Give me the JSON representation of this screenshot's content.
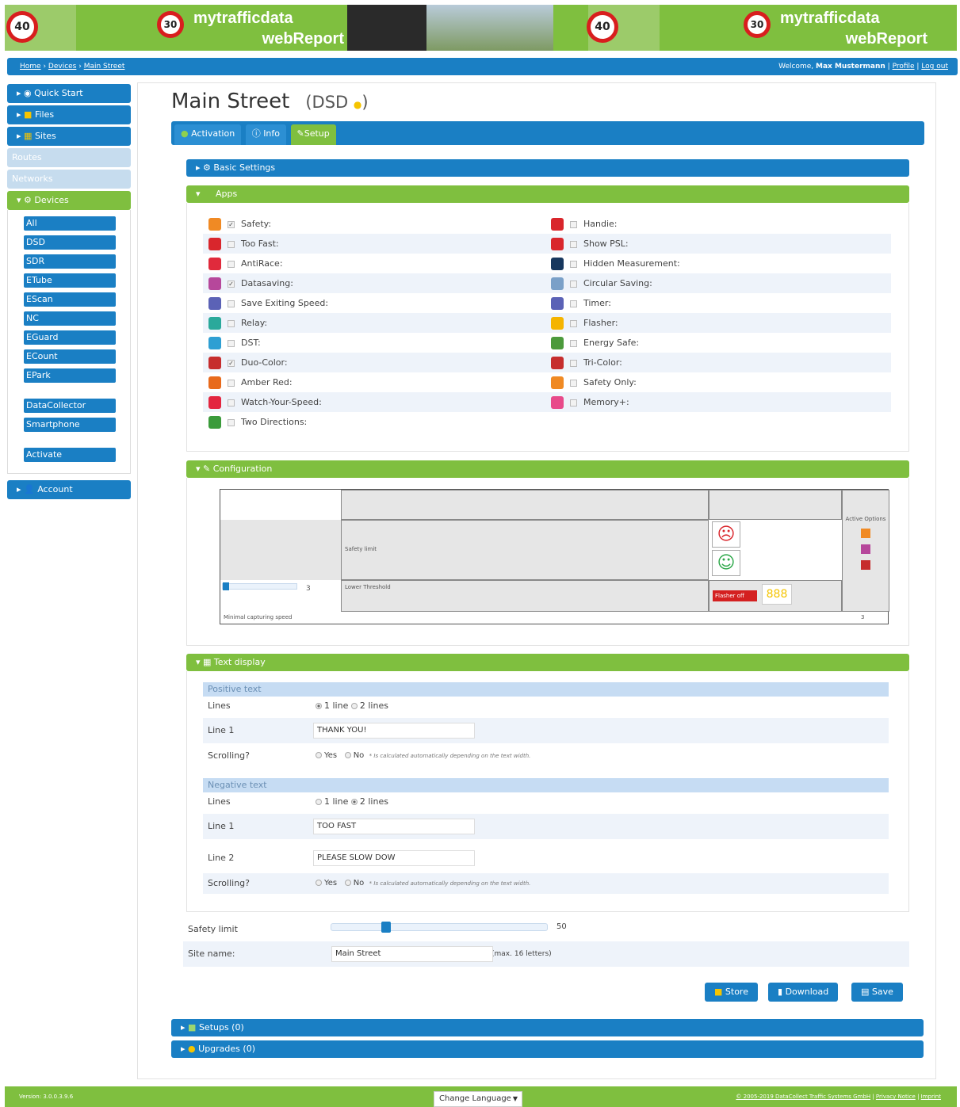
{
  "header": {
    "brand_line1": "mytrafficdata",
    "brand_line2": "webReport",
    "sign_speed": "40",
    "sign_cone": "30"
  },
  "breadcrumb": {
    "home": "Home",
    "devices": "Devices",
    "current": "Main Street",
    "welcome_prefix": "Welcome,",
    "user": "Max Mustermann",
    "profile": "Profile",
    "logout": "Log out"
  },
  "sidebar": {
    "top": [
      {
        "label": "Quick Start"
      },
      {
        "label": "Files"
      },
      {
        "label": "Sites"
      }
    ],
    "routes": "Routes",
    "networks": "Networks",
    "devices": "Devices",
    "device_types": [
      "All",
      "DSD",
      "SDR",
      "ETube",
      "EScan",
      "NC",
      "EGuard",
      "ECount",
      "EPark"
    ],
    "extra": [
      "DataCollector",
      "Smartphone"
    ],
    "activate": "Activate",
    "account": "Account"
  },
  "page": {
    "title": "Main Street",
    "device_prefix": "(DSD",
    "device_suffix": ")"
  },
  "tabs": [
    "Activation",
    "Info",
    "Setup"
  ],
  "sections": {
    "basic": "Basic Settings",
    "apps": "Apps",
    "configuration": "Configuration",
    "text_display": "Text display",
    "setups": "Setups (0)",
    "upgrades": "Upgrades (0)"
  },
  "apps_left": [
    {
      "label": "Safety:",
      "checked": true,
      "color": "#f08a24"
    },
    {
      "label": "Too Fast:",
      "checked": false,
      "color": "#d9262c"
    },
    {
      "label": "AntiRace:",
      "checked": false,
      "color": "#e02a3c"
    },
    {
      "label": "Datasaving:",
      "checked": true,
      "color": "#b6479b"
    },
    {
      "label": "Save Exiting Speed:",
      "checked": false,
      "color": "#5b62b6"
    },
    {
      "label": "Relay:",
      "checked": false,
      "color": "#2aa99b"
    },
    {
      "label": "DST:",
      "checked": false,
      "color": "#2e9fd3"
    },
    {
      "label": "Duo-Color:",
      "checked": true,
      "color": "#c62d2d"
    },
    {
      "label": "Amber Red:",
      "checked": false,
      "color": "#e86a1c"
    },
    {
      "label": "Watch-Your-Speed:",
      "checked": false,
      "color": "#e3263f"
    },
    {
      "label": "Two Directions:",
      "checked": false,
      "color": "#3b9b3b"
    }
  ],
  "apps_right": [
    {
      "label": "Handie:",
      "checked": false,
      "color": "#d9262c"
    },
    {
      "label": "Show PSL:",
      "checked": false,
      "color": "#d9262c"
    },
    {
      "label": "Hidden Measurement:",
      "checked": false,
      "color": "#17375e"
    },
    {
      "label": "Circular Saving:",
      "checked": false,
      "color": "#7aa0c8"
    },
    {
      "label": "Timer:",
      "checked": false,
      "color": "#5b62b6"
    },
    {
      "label": "Flasher:",
      "checked": false,
      "color": "#f5b400"
    },
    {
      "label": "Energy Safe:",
      "checked": false,
      "color": "#4c9a3c"
    },
    {
      "label": "Tri-Color:",
      "checked": false,
      "color": "#c62d2d"
    },
    {
      "label": "Safety Only:",
      "checked": false,
      "color": "#f08a24"
    },
    {
      "label": "Memory+:",
      "checked": false,
      "color": "#e84a8a"
    }
  ],
  "config": {
    "safety_limit": "Safety limit",
    "lower_threshold": "Lower Threshold",
    "lower_value": "3",
    "minimal": "Minimal capturing speed",
    "minimal_value": "3",
    "active_options": "Active Options",
    "img_alt": "Flasher off"
  },
  "text_display": {
    "positive_header": "Positive text",
    "negative_header": "Negative text",
    "lines_label": "Lines",
    "line1_label": "Line 1",
    "line2_label": "Line 2",
    "scrolling_label": "Scrolling?",
    "one_line": "1 line",
    "two_lines": "2 lines",
    "yes": "Yes",
    "no": "No",
    "note": "* Is calculated automatically depending on the text width.",
    "positive_line1": "THANK YOU!",
    "negative_line1": "TOO FAST",
    "negative_line2": "PLEASE SLOW DOW"
  },
  "bottom": {
    "safety_limit_label": "Safety limit",
    "safety_limit_value": "50",
    "safety_limit_fraction": 0.24,
    "site_name_label": "Site name:",
    "site_name_value": "Main Street",
    "site_name_hint": "(max. 16 letters)"
  },
  "actions": {
    "store": "Store",
    "download": "Download",
    "save": "Save"
  },
  "footer": {
    "version": "Version: 3.0.0.3.9.6",
    "language": "Change Language",
    "copyright": "© 2005-2019 DataCollect Traffic Systems GmbH",
    "privacy": "Privacy Notice",
    "imprint": "Imprint"
  }
}
